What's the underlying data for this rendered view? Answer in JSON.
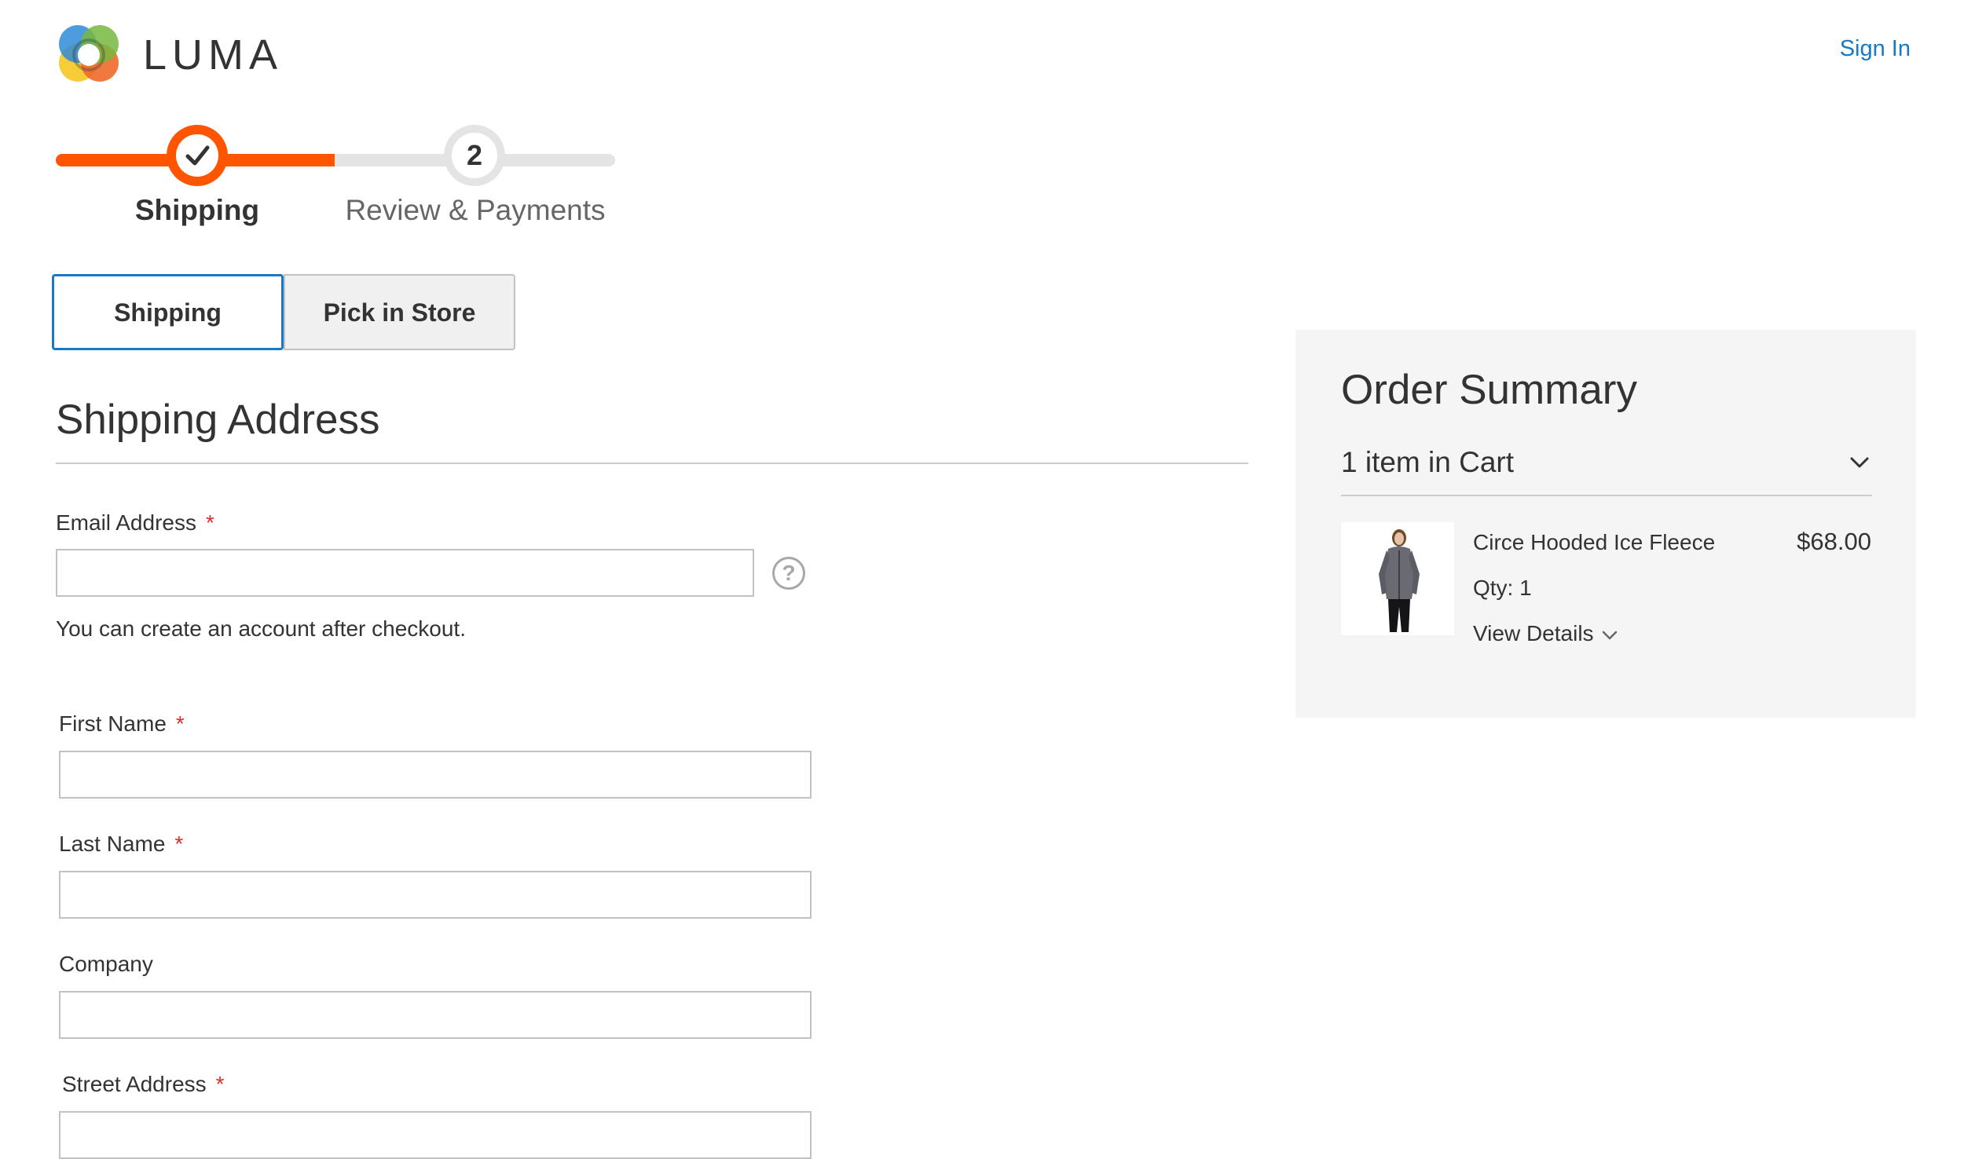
{
  "header": {
    "logo_text": "LUMA",
    "sign_in_label": "Sign In"
  },
  "progress": {
    "steps": [
      {
        "label": "Shipping",
        "status": "complete"
      },
      {
        "label": "Review & Payments",
        "number": "2",
        "status": "pending"
      }
    ],
    "accent_color": "#ff5501"
  },
  "tabs": [
    {
      "label": "Shipping",
      "active": true
    },
    {
      "label": "Pick in Store",
      "active": false
    }
  ],
  "shipping_address": {
    "title": "Shipping Address",
    "required_marker": "*",
    "fields": {
      "email": {
        "label": "Email Address",
        "value": "",
        "required": true,
        "note": "You can create an account after checkout.",
        "help_glyph": "?"
      },
      "first_name": {
        "label": "First Name",
        "value": "",
        "required": true
      },
      "last_name": {
        "label": "Last Name",
        "value": "",
        "required": true
      },
      "company": {
        "label": "Company",
        "value": "",
        "required": false
      },
      "street": {
        "label": "Street Address",
        "value": "",
        "required": true
      }
    }
  },
  "order_summary": {
    "title": "Order Summary",
    "cart_count": "1 item in Cart",
    "items": [
      {
        "name": "Circe Hooded Ice Fleece",
        "price": "$68.00",
        "qty": "Qty: 1",
        "details_label": "View Details"
      }
    ]
  },
  "colors": {
    "link": "#1979c3",
    "required": "#e02b27",
    "active_tab_border": "#1979c3"
  }
}
